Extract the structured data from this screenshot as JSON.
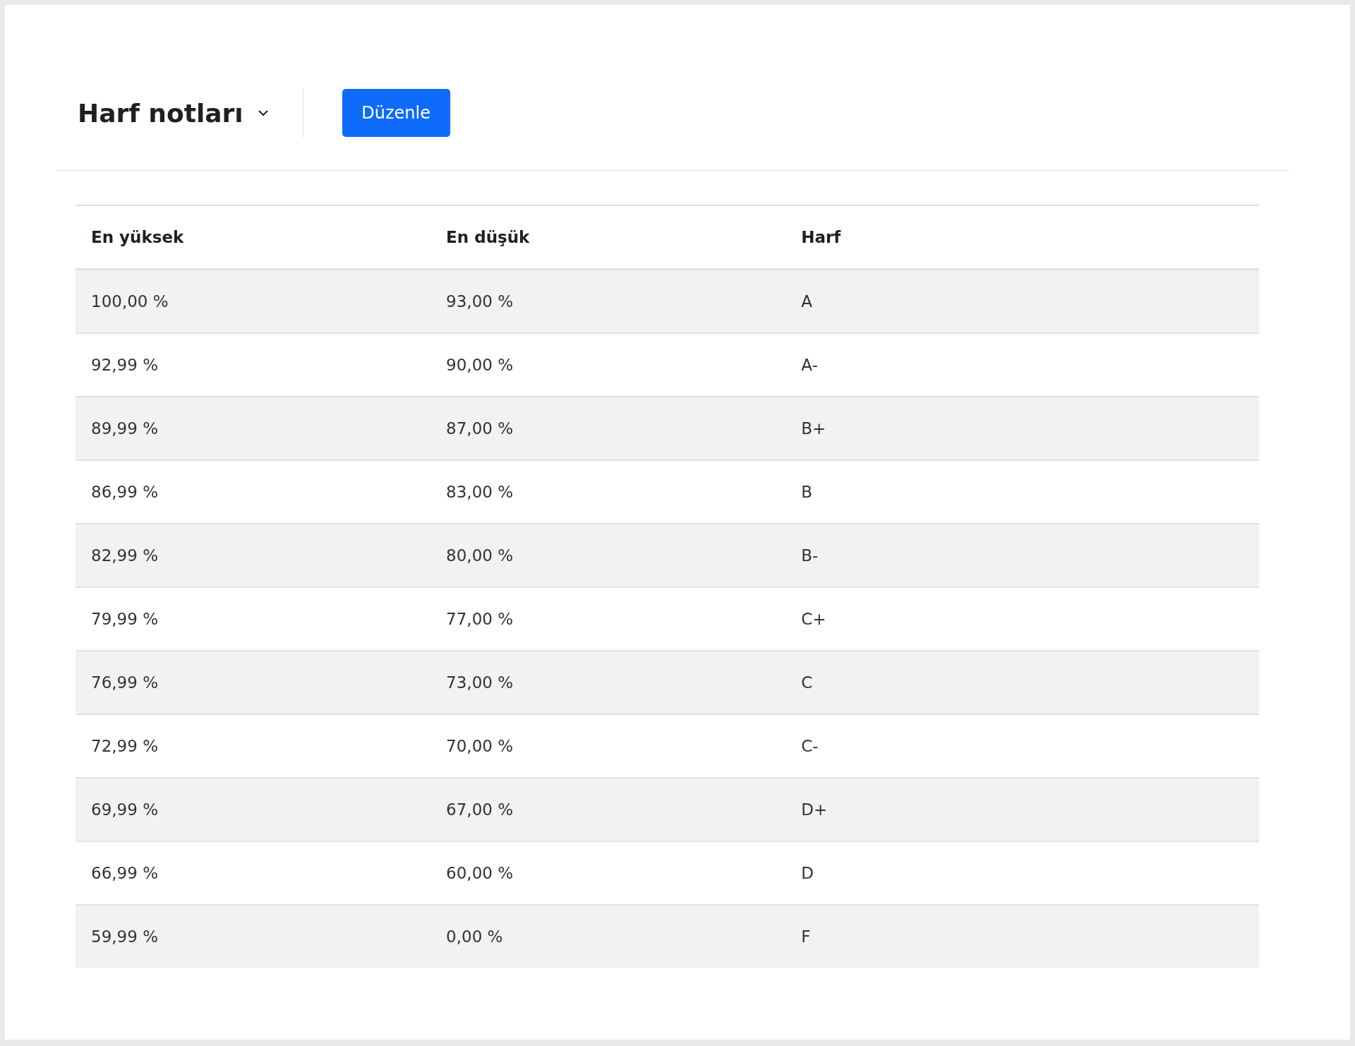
{
  "header": {
    "title": "Harf notları",
    "edit_button": "Düzenle"
  },
  "table": {
    "columns": [
      "En yüksek",
      "En düşük",
      "Harf"
    ],
    "rows": [
      {
        "highest": "100,00 %",
        "lowest": "93,00 %",
        "letter": "A"
      },
      {
        "highest": "92,99 %",
        "lowest": "90,00 %",
        "letter": "A-"
      },
      {
        "highest": "89,99 %",
        "lowest": "87,00 %",
        "letter": "B+"
      },
      {
        "highest": "86,99 %",
        "lowest": "83,00 %",
        "letter": "B"
      },
      {
        "highest": "82,99 %",
        "lowest": "80,00 %",
        "letter": "B-"
      },
      {
        "highest": "79,99 %",
        "lowest": "77,00 %",
        "letter": "C+"
      },
      {
        "highest": "76,99 %",
        "lowest": "73,00 %",
        "letter": "C"
      },
      {
        "highest": "72,99 %",
        "lowest": "70,00 %",
        "letter": "C-"
      },
      {
        "highest": "69,99 %",
        "lowest": "67,00 %",
        "letter": "D+"
      },
      {
        "highest": "66,99 %",
        "lowest": "60,00 %",
        "letter": "D"
      },
      {
        "highest": "59,99 %",
        "lowest": "0,00 %",
        "letter": "F"
      }
    ]
  }
}
